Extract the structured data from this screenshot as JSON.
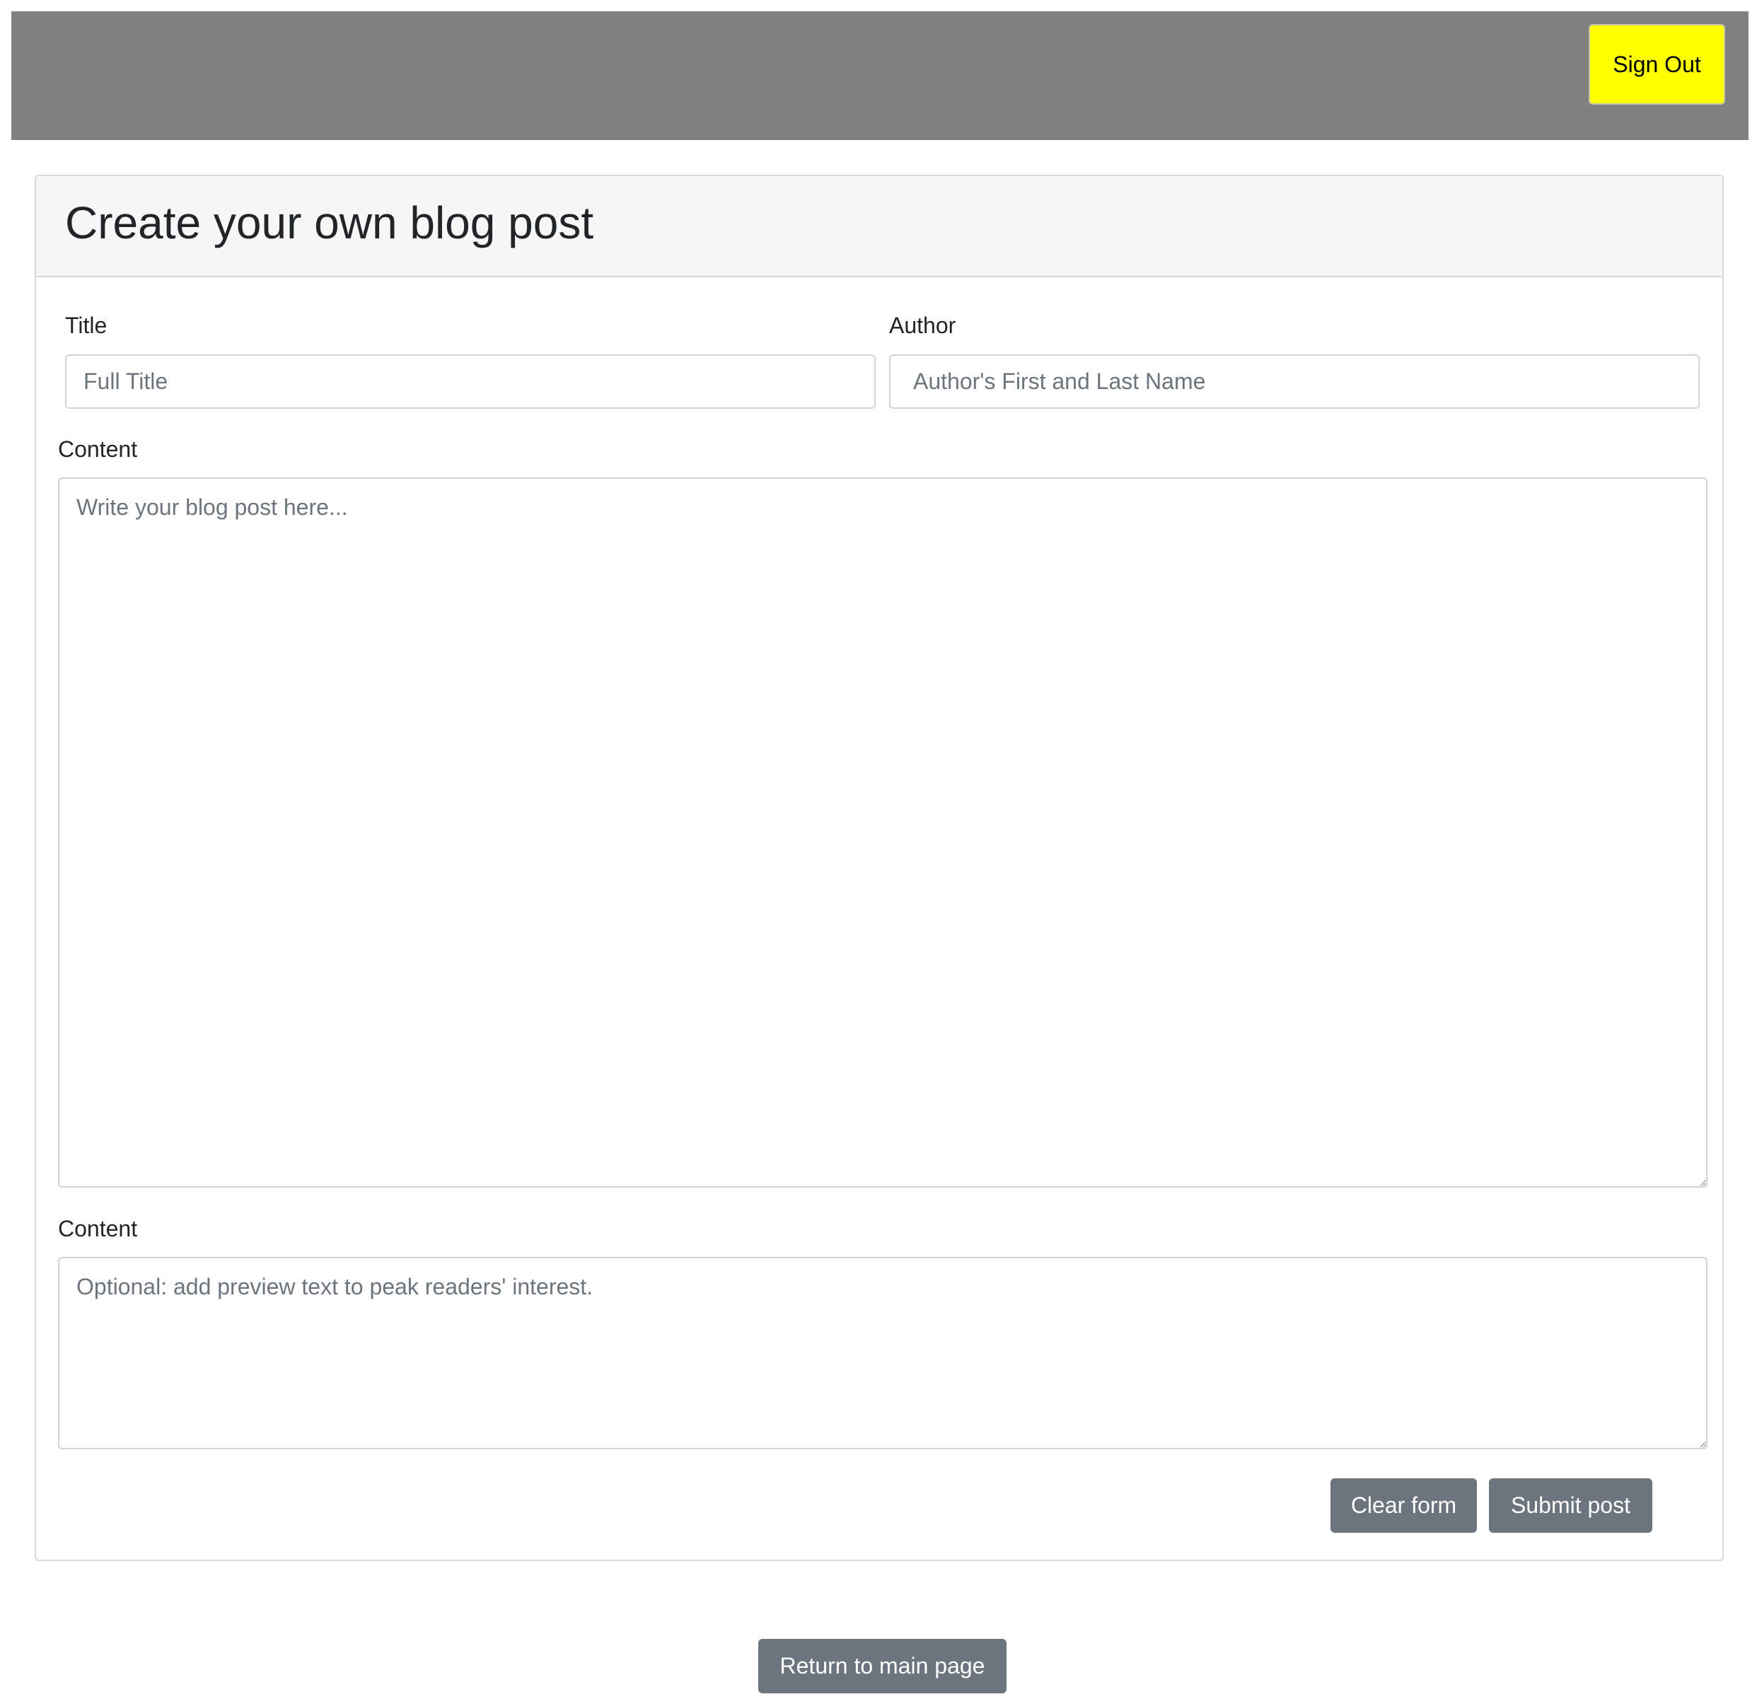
{
  "header": {
    "sign_out_label": "Sign Out"
  },
  "form": {
    "heading": "Create your own blog post",
    "title_label": "Title",
    "title_placeholder": "Full Title",
    "title_value": "",
    "author_label": "Author",
    "author_placeholder": "Author's First and Last Name",
    "author_value": "",
    "content_label": "Content",
    "content_placeholder": "Write your blog post here...",
    "preview_label": "Content",
    "preview_placeholder": "Optional: add preview text to peak readers' interest.",
    "clear_label": "Clear form",
    "submit_label": "Submit post"
  },
  "footer": {
    "return_label": "Return to main page"
  },
  "colors": {
    "topbar": "#808080",
    "sign_out_button": "#ffff00",
    "secondary_button": "#6c757d"
  }
}
